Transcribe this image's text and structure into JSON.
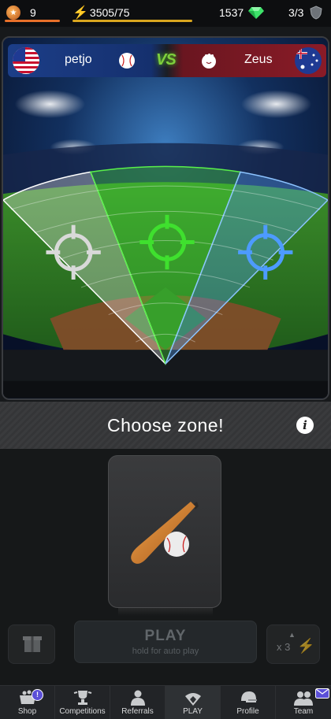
{
  "topbar": {
    "level": "9",
    "energy": "3505/75",
    "gems": "1537",
    "tickets": "3/3"
  },
  "match": {
    "player_left": "petjo",
    "player_right": "Zeus",
    "vs": "VS",
    "left_flag": "usa-flag",
    "right_flag": "australia-flag"
  },
  "zones": [
    "left-zone",
    "center-zone",
    "right-zone"
  ],
  "choose_text": "Choose zone!",
  "info_glyph": "i",
  "play": {
    "label": "PLAY",
    "hint": "hold for auto play",
    "multiplier": "x 3"
  },
  "nav": {
    "items": [
      {
        "label": "Shop",
        "badge": "!"
      },
      {
        "label": "Competitions"
      },
      {
        "label": "Referrals"
      },
      {
        "label": "PLAY"
      },
      {
        "label": "Profile"
      },
      {
        "label": "Team"
      }
    ]
  },
  "colors": {
    "accent_orange": "#e8702a",
    "energy_yellow": "#ffc524",
    "zone_green": "#47e63a",
    "zone_blue": "#5aa6ff",
    "zone_white": "#e6e6e6"
  }
}
